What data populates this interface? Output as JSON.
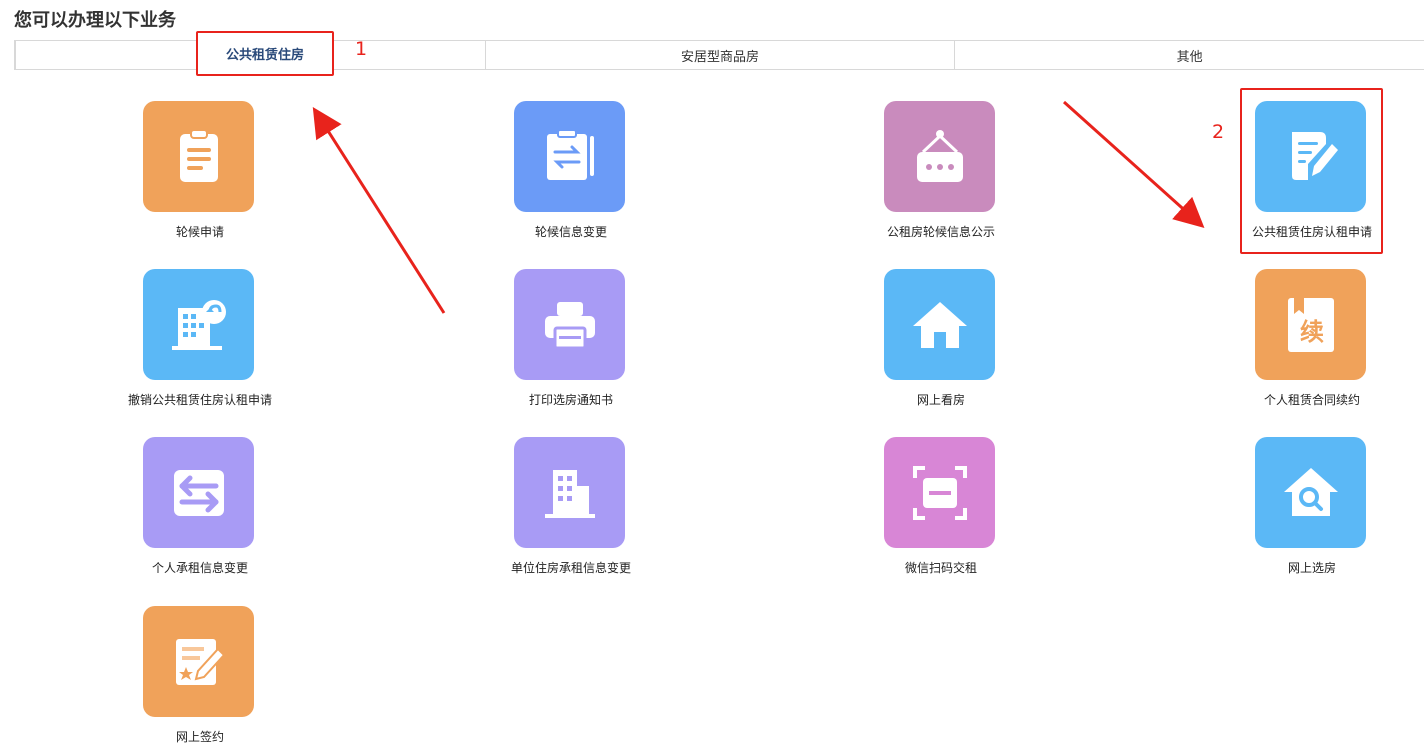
{
  "page": {
    "title": "您可以办理以下业务"
  },
  "tabs": [
    {
      "label": "公共租赁住房",
      "active": true
    },
    {
      "label": "安居型商品房",
      "active": false
    },
    {
      "label": "其他",
      "active": false
    }
  ],
  "tiles": [
    {
      "label": "轮候申请",
      "icon": "clipboard-icon",
      "color": "#f0a25a"
    },
    {
      "label": "轮候信息变更",
      "icon": "clipboard-swap-icon",
      "color": "#6b9bf7"
    },
    {
      "label": "公租房轮候信息公示",
      "icon": "hanging-sign-icon",
      "color": "#c98bbd"
    },
    {
      "label": "公共租赁住房认租申请",
      "icon": "edit-document-icon",
      "color": "#5bb8f6"
    },
    {
      "label": "撤销公共租赁住房认租申请",
      "icon": "building-revoke-icon",
      "color": "#5bb8f6"
    },
    {
      "label": "打印选房通知书",
      "icon": "printer-icon",
      "color": "#a89bf5"
    },
    {
      "label": "网上看房",
      "icon": "house-icon",
      "color": "#5bb8f6"
    },
    {
      "label": "个人租赁合同续约",
      "icon": "renew-contract-icon",
      "color": "#f0a25a",
      "glyph": "续"
    },
    {
      "label": "个人承租信息变更",
      "icon": "exchange-icon",
      "color": "#a89bf5"
    },
    {
      "label": "单位住房承租信息变更",
      "icon": "office-building-icon",
      "color": "#a89bf5"
    },
    {
      "label": "微信扫码交租",
      "icon": "scan-qr-icon",
      "color": "#d886d6"
    },
    {
      "label": "网上选房",
      "icon": "house-search-icon",
      "color": "#5bb8f6"
    },
    {
      "label": "网上签约",
      "icon": "sign-contract-icon",
      "color": "#f0a25a"
    }
  ],
  "annotations": [
    {
      "number": "1",
      "color": "#e8231c"
    },
    {
      "number": "2",
      "color": "#e8231c"
    }
  ]
}
